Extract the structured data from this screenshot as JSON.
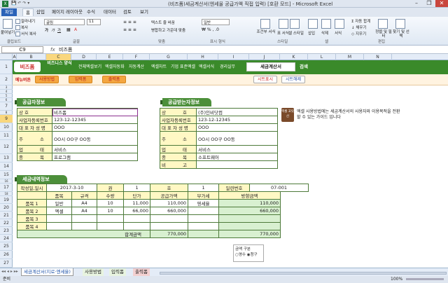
{
  "window": {
    "title": "(비즈폼)세금계산서(엔세율 공급가액 직접 입력) [호환 모드] - Microsoft Excel",
    "minimize": "–",
    "restore": "❐",
    "close": "✕"
  },
  "ribbon_tabs": {
    "file": "파일",
    "items": [
      "홈",
      "삽입",
      "페이지 레이아웃",
      "수식",
      "데이터",
      "검토",
      "보기"
    ]
  },
  "ribbon": {
    "paste": "붙여넣기",
    "cut": "잘라내기",
    "copy": "복사",
    "format_painter": "서식 복사",
    "font_name": "굴림",
    "font_size": "11",
    "bold": "가",
    "italic": "가",
    "underline": "가",
    "wrap_text": "텍스트 줄 바꿈",
    "merge_center": "병합하고 가운데 맞춤",
    "number_format": "일반",
    "conditional_format": "조건부 서식",
    "format_table": "표 서식",
    "cell_style": "셀 스타일",
    "insert": "삽입",
    "delete": "삭제",
    "format": "서식",
    "autosum": "자동 합계",
    "fill": "채우기",
    "clear": "지우기",
    "sort_filter": "정렬 및 필터",
    "find_select": "찾기 및 선택",
    "groups": {
      "clipboard": "클립보드",
      "font": "글꼴",
      "align": "맞춤",
      "number": "표시 형식",
      "style": "스타일",
      "cells": "셀",
      "edit": "편집"
    }
  },
  "formula_bar": {
    "name_box": "C9",
    "fx": "fx",
    "value": "비즈폼"
  },
  "columns": [
    "A",
    "B",
    "C",
    "D",
    "E",
    "F",
    "G",
    "H",
    "I",
    "J",
    "K",
    "L",
    "M",
    "N"
  ],
  "selected_column": "C",
  "rows": [
    "1",
    "2",
    "3",
    "4",
    "5",
    "6",
    "7",
    "8",
    "9",
    "10",
    "11",
    "12",
    "13",
    "14",
    "15",
    "16",
    "17",
    "18",
    "19",
    "20",
    "21",
    "22",
    "23",
    "24",
    "25",
    "26",
    "27"
  ],
  "selected_row": "9",
  "topbar": {
    "logo": "비즈폼",
    "logo_sub": "비즈니스 양식",
    "nav": [
      "전체엑셀보기",
      "엑셀자동화",
      "자동계산",
      "엑셀차트",
      "기업 표준엑셀",
      "엑셀서식",
      "경리실무"
    ],
    "search_value": "세금계산서",
    "search_button": "검색"
  },
  "subbar": {
    "label": "메뉴버튼",
    "buttons": [
      "사용방법",
      "입력폼",
      "출력폼"
    ],
    "print_button": "시트표시",
    "print_button2": "시트해제"
  },
  "supplier": {
    "header": "공급자정보",
    "rows": [
      {
        "label": "상호",
        "value": "비즈폼"
      },
      {
        "label": "사업자등록번호",
        "value": "123-12-12345"
      },
      {
        "label": "대표자성명",
        "value": "OOO"
      },
      {
        "label": "주소",
        "value": "OO시 OO구 OO동"
      },
      {
        "label": "업태",
        "value": "서비스"
      },
      {
        "label": "종목",
        "value": "프로그램"
      }
    ]
  },
  "buyer": {
    "header": "공급받는자정보",
    "rows": [
      {
        "label": "상호",
        "value": "(주)인비닷컴"
      },
      {
        "label": "사업자등록번호",
        "value": "123-12-12345"
      },
      {
        "label": "대표자성명",
        "value": "OOO"
      },
      {
        "label": "주소",
        "value": "OO시 OO구 OO동"
      },
      {
        "label": "업태",
        "value": "서비스"
      },
      {
        "label": "종목",
        "value": "소프트웨어"
      },
      {
        "label": "비고",
        "value": ""
      }
    ]
  },
  "note": {
    "icon_text": "엑셀 꼬릿선",
    "text": "엑셀 사용방법에는 세금계산서의 사용자와 이용목적을 전환할 수 있는 가이드 입니다"
  },
  "tax": {
    "header": "세금내역정보",
    "row1": {
      "date_label": "작성일,일시",
      "date_value": "2017-3-10",
      "book_label": "권",
      "book_value": "1",
      "no_label": "호",
      "no_value": "1",
      "serial_label": "일련번호",
      "serial_value": "07-001"
    },
    "columns": [
      "품목",
      "규격",
      "수량",
      "단가",
      "공급가액",
      "부가세",
      "방향금액"
    ],
    "items": [
      {
        "label": "품목 1",
        "name": "일반",
        "spec": "A4",
        "qty": "10",
        "price": "11,000",
        "supply": "110,000",
        "vat": "영세율",
        "amount": "110,000"
      },
      {
        "label": "품목 2",
        "name": "엑셀",
        "spec": "A4",
        "qty": "10",
        "price": "66,000",
        "supply": "660,000",
        "vat": "",
        "amount": "660,000"
      },
      {
        "label": "품목 3",
        "name": "",
        "spec": "",
        "qty": "",
        "price": "",
        "supply": "",
        "vat": "",
        "amount": ""
      },
      {
        "label": "품목 4",
        "name": "",
        "spec": "",
        "qty": "",
        "price": "",
        "supply": "",
        "vat": "",
        "amount": ""
      }
    ],
    "total_label": "합계금액",
    "total_supply": "770,000",
    "total_amount": "770,000"
  },
  "radio": {
    "title": "금액 구분",
    "options": [
      "영수",
      "청구"
    ],
    "selected": "청구"
  },
  "sheet_tabs": [
    "세금계산서(지로·엔세율)",
    "사용방법",
    "입력폼",
    "출력폼"
  ],
  "status": {
    "ready": "준비",
    "zoom": "100%"
  },
  "colors": {
    "green": "#3a8a2a",
    "header_green": "#4c8f3a",
    "label_yellow": "#fff8c4",
    "orange": "#f4a640"
  }
}
